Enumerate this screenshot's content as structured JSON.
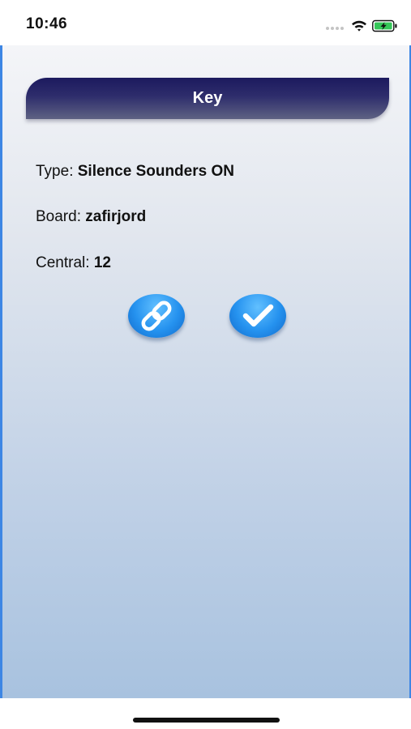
{
  "status_bar": {
    "time": "10:46"
  },
  "header": {
    "title": "Key"
  },
  "info": {
    "type_label": "Type: ",
    "type_value": "Silence Sounders ON",
    "board_label": "Board: ",
    "board_value": "zafirjord",
    "central_label": "Central: ",
    "central_value": "12"
  },
  "actions": {
    "link_icon": "link-icon",
    "confirm_icon": "checkmark-icon"
  },
  "colors": {
    "accent_blue": "#3d86e4",
    "header_dark": "#1c1a5e",
    "button_blue": "#2592ef",
    "battery_green": "#35c759"
  }
}
